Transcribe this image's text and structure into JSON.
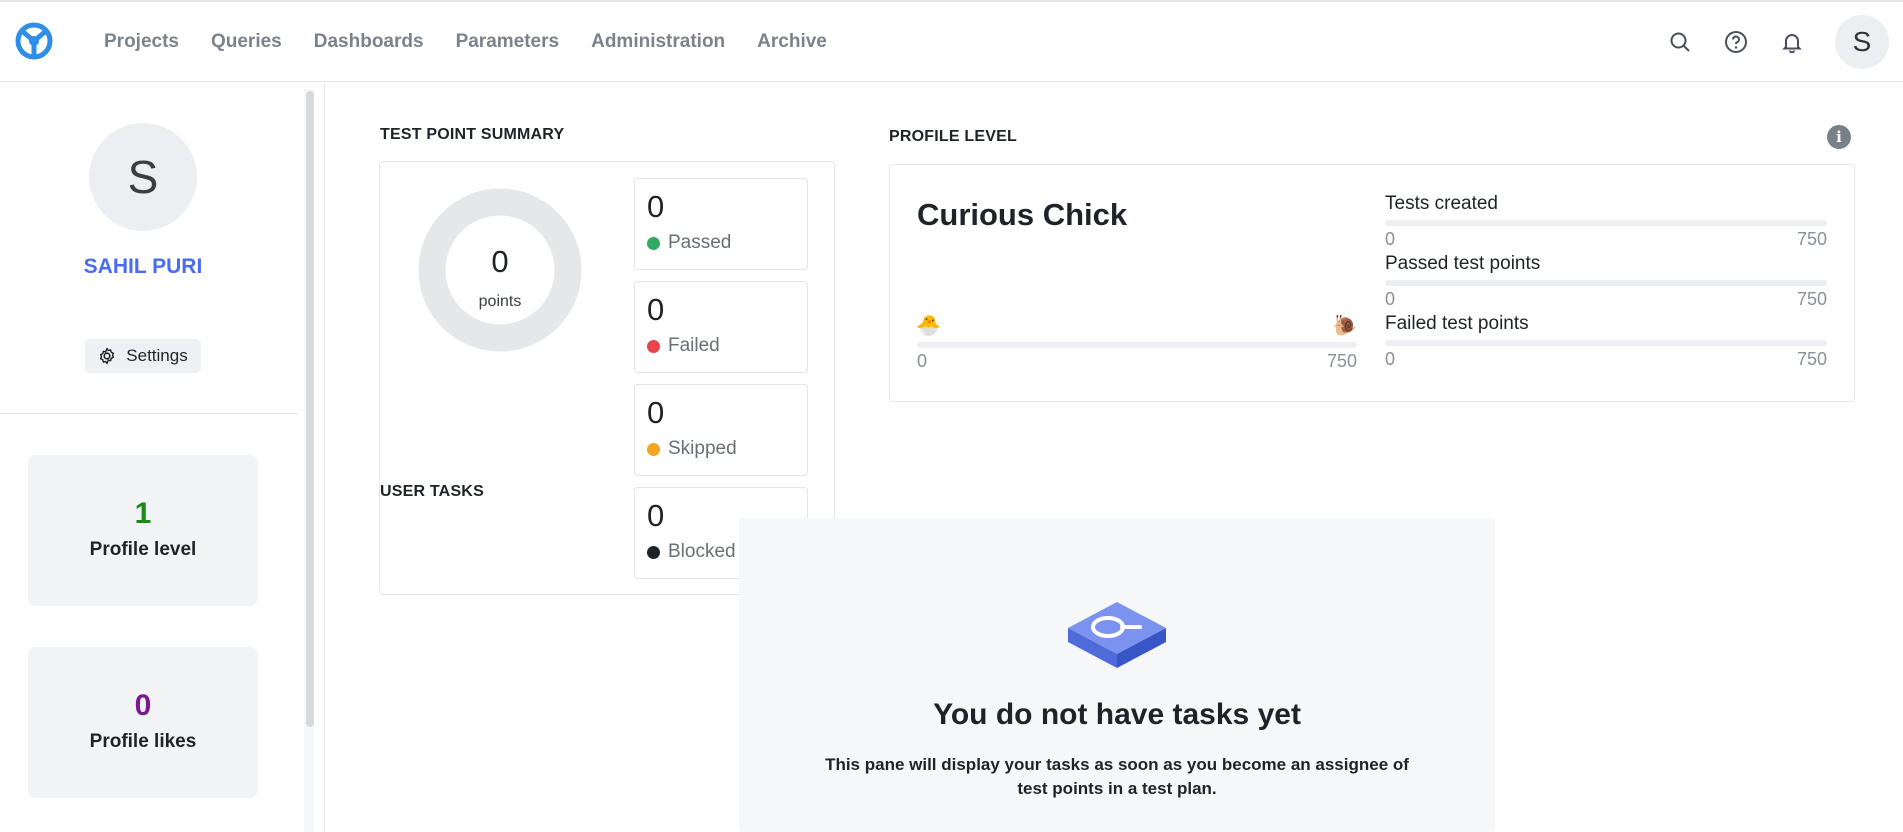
{
  "header": {
    "nav": [
      "Projects",
      "Queries",
      "Dashboards",
      "Parameters",
      "Administration",
      "Archive"
    ],
    "avatar_letter": "S",
    "icons": [
      "search-icon",
      "help-icon",
      "bell-icon"
    ]
  },
  "sidebar": {
    "avatar_letter": "S",
    "user_name": "SAHIL PURI",
    "settings_label": "Settings",
    "stats": [
      {
        "value": "1",
        "label": "Profile level",
        "color": "#1a8a1a"
      },
      {
        "value": "0",
        "label": "Profile likes",
        "color": "#7b1a8f"
      }
    ]
  },
  "summary": {
    "title": "TEST POINT SUMMARY",
    "total": "0",
    "total_label": "points",
    "statuses": [
      {
        "count": "0",
        "label": "Passed",
        "color": "#2eaa63"
      },
      {
        "count": "0",
        "label": "Failed",
        "color": "#e8434a"
      },
      {
        "count": "0",
        "label": "Skipped",
        "color": "#f5a524"
      },
      {
        "count": "0",
        "label": "Blocked",
        "color": "#1f2328"
      }
    ],
    "user_tasks_title": "USER TASKS"
  },
  "level": {
    "title": "PROFILE LEVEL",
    "info": "i",
    "name": "Curious Chick",
    "emoji_start": "🐣",
    "emoji_end": "🐌",
    "progress_min": "0",
    "progress_max": "750",
    "metrics": [
      {
        "label": "Tests created",
        "min": "0",
        "max": "750"
      },
      {
        "label": "Passed test points",
        "min": "0",
        "max": "750"
      },
      {
        "label": "Failed test points",
        "min": "0",
        "max": "750"
      }
    ]
  },
  "tasks_empty": {
    "title": "You do not have tasks yet",
    "text": "This pane will display your tasks as soon as you become an assignee of test points in a test plan."
  }
}
